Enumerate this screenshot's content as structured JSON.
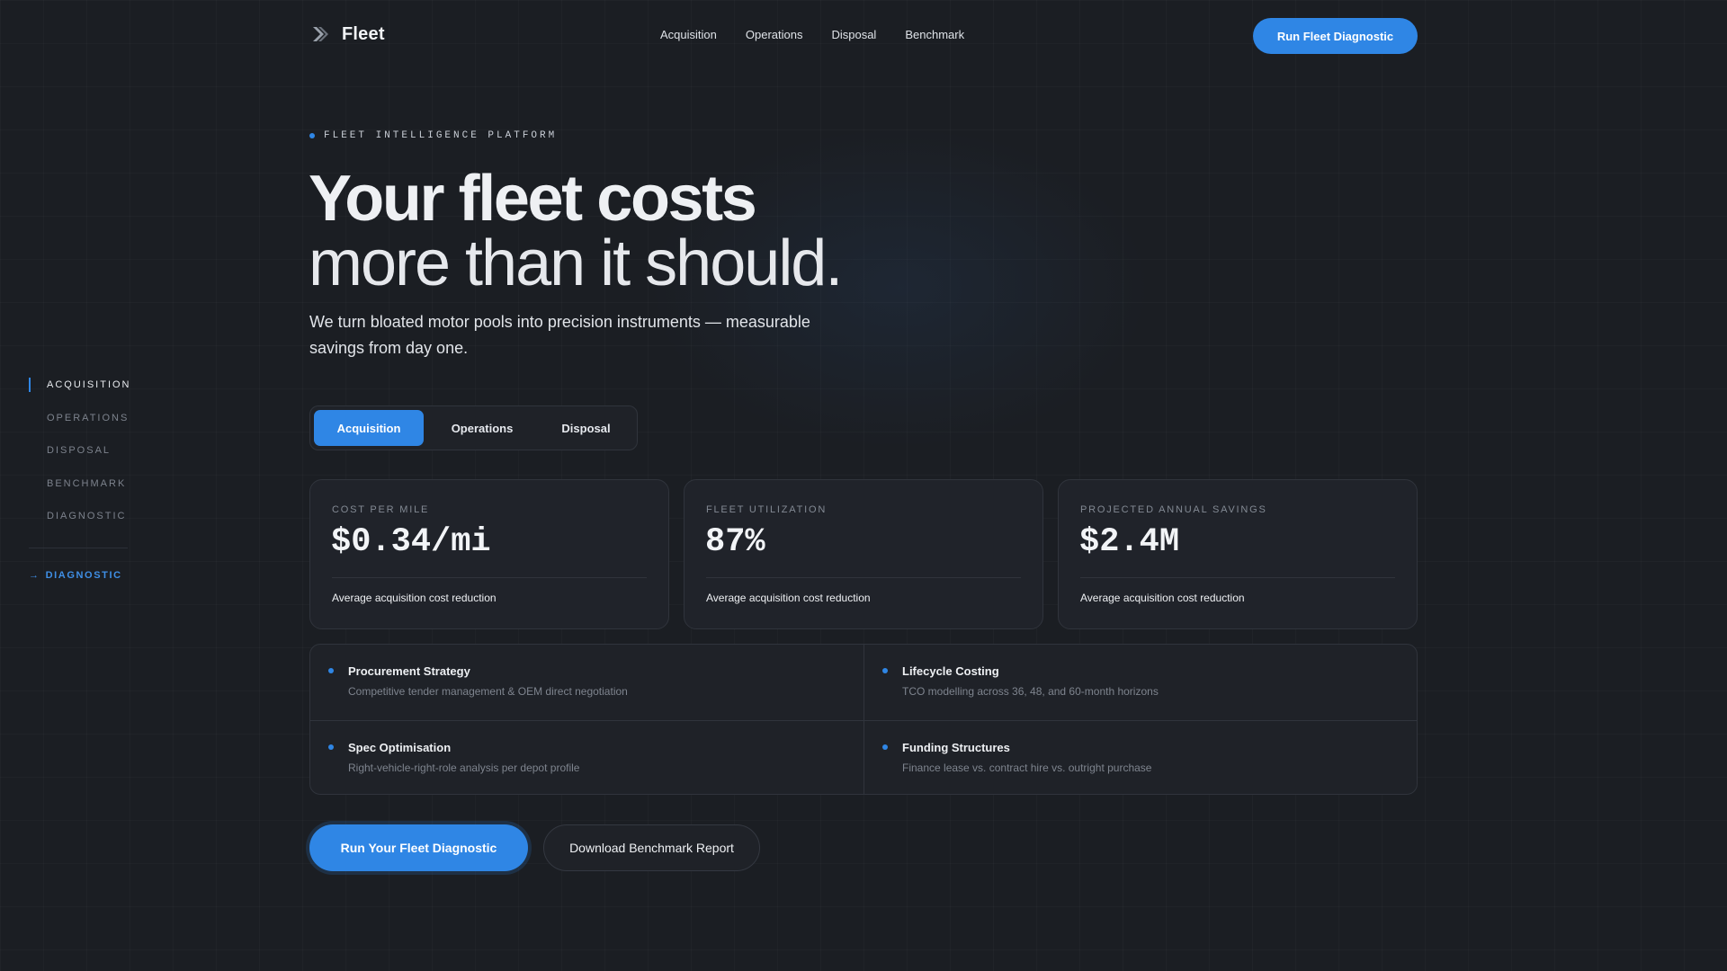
{
  "brand": {
    "name": "Fleet",
    "icon": "chevron-double-icon"
  },
  "nav": {
    "links": [
      "Acquisition",
      "Operations",
      "Disposal",
      "Benchmark"
    ],
    "cta": "Run Fleet Diagnostic"
  },
  "rail": {
    "items": [
      "ACQUISITION",
      "OPERATIONS",
      "DISPOSAL",
      "BENCHMARK",
      "DIAGNOSTIC"
    ],
    "active_index": 0,
    "link": {
      "arrow": "→",
      "label": "DIAGNOSTIC"
    }
  },
  "hero": {
    "eyebrow": "FLEET INTELLIGENCE PLATFORM",
    "headline_line1": "Your fleet costs",
    "headline_line2": "more than it should.",
    "lede": "We turn bloated motor pools into precision instruments — measurable savings from day one."
  },
  "tabs": {
    "items": [
      "Acquisition",
      "Operations",
      "Disposal"
    ],
    "active_index": 0
  },
  "metrics": [
    {
      "label": "COST PER MILE",
      "value": "$0.34/mi",
      "note": "Average acquisition cost reduction"
    },
    {
      "label": "FLEET UTILIZATION",
      "value": "87%",
      "note": "Average acquisition cost reduction"
    },
    {
      "label": "PROJECTED ANNUAL SAVINGS",
      "value": "$2.4M",
      "note": "Average acquisition cost reduction"
    }
  ],
  "services": [
    {
      "title": "Procurement Strategy",
      "desc": "Competitive tender management & OEM direct negotiation"
    },
    {
      "title": "Lifecycle Costing",
      "desc": "TCO modelling across 36, 48, and 60-month horizons"
    },
    {
      "title": "Spec Optimisation",
      "desc": "Right-vehicle-right-role analysis per depot profile"
    },
    {
      "title": "Funding Structures",
      "desc": "Finance lease vs. contract hire vs. outright purchase"
    }
  ],
  "cta": {
    "primary": "Run Your Fleet Diagnostic",
    "secondary": "Download Benchmark Report"
  },
  "colors": {
    "accent": "#2f86e5",
    "background": "#1b1e23",
    "card": "#20232a",
    "border": "#30343c"
  }
}
